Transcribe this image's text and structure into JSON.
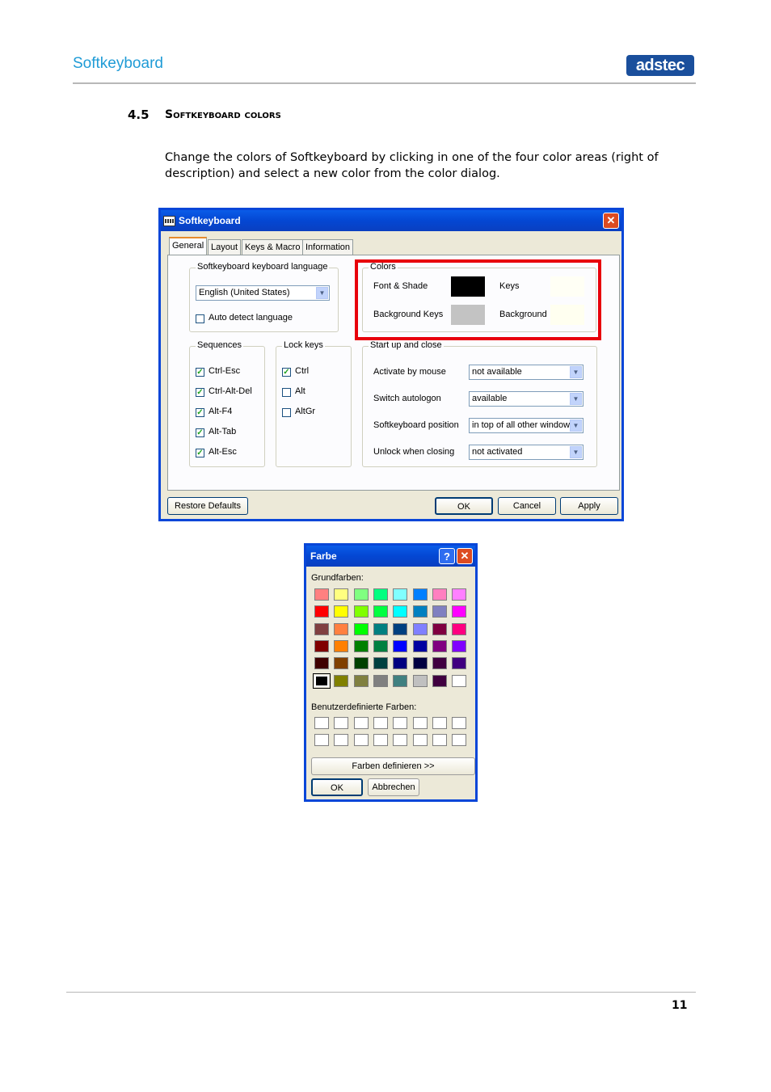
{
  "page": {
    "header_title": "Softkeyboard",
    "logo_text": "adstec",
    "section_number": "4.5",
    "section_title": "Softkeyboard colors",
    "paragraph": "Change the colors of Softkeyboard by clicking in one of the four color areas (right of description) and select a new color from the color dialog.",
    "page_number": "11"
  },
  "softkeyboard_dialog": {
    "title": "Softkeyboard",
    "tabs": [
      "General",
      "Layout",
      "Keys & Macro",
      "Information"
    ],
    "language_group": {
      "label": "Softkeyboard keyboard language",
      "selected": "English (United States)",
      "auto_detect_label": "Auto detect language",
      "auto_detect_checked": false
    },
    "colors_group": {
      "label": "Colors",
      "font_shade_label": "Font & Shade",
      "font_shade_color": "#000000",
      "keys_label": "Keys",
      "keys_color": "#fffff5",
      "bg_keys_label": "Background Keys",
      "bg_keys_color": "#c3c3c3",
      "background_label": "Background",
      "background_color": "#fffff0"
    },
    "sequences_group": {
      "label": "Sequences",
      "items": [
        {
          "label": "Ctrl-Esc",
          "checked": true
        },
        {
          "label": "Ctrl-Alt-Del",
          "checked": true
        },
        {
          "label": "Alt-F4",
          "checked": true
        },
        {
          "label": "Alt-Tab",
          "checked": true
        },
        {
          "label": "Alt-Esc",
          "checked": true
        }
      ]
    },
    "lock_keys_group": {
      "label": "Lock keys",
      "items": [
        {
          "label": "Ctrl",
          "checked": true
        },
        {
          "label": "Alt",
          "checked": false
        },
        {
          "label": "AltGr",
          "checked": false
        }
      ]
    },
    "startup_group": {
      "label": "Start up and close",
      "rows": [
        {
          "label": "Activate by mouse",
          "value": "not available"
        },
        {
          "label": "Switch autologon",
          "value": "available"
        },
        {
          "label": "Softkeyboard position",
          "value": "in top of all other windows"
        },
        {
          "label": "Unlock when closing",
          "value": "not activated"
        }
      ]
    },
    "buttons": {
      "restore": "Restore Defaults",
      "ok": "OK",
      "cancel": "Cancel",
      "apply": "Apply"
    }
  },
  "color_dialog": {
    "title": "Farbe",
    "basic_colors_label": "Grundfarben:",
    "basic_colors": [
      [
        "#ff8080",
        "#ffff80",
        "#80ff80",
        "#00ff80",
        "#80ffff",
        "#0080ff",
        "#ff80c0",
        "#ff80ff"
      ],
      [
        "#ff0000",
        "#ffff00",
        "#80ff00",
        "#00ff40",
        "#00ffff",
        "#0080c0",
        "#8080c0",
        "#ff00ff"
      ],
      [
        "#804040",
        "#ff8040",
        "#00ff00",
        "#008080",
        "#004080",
        "#8080ff",
        "#800040",
        "#ff0080"
      ],
      [
        "#800000",
        "#ff8000",
        "#008000",
        "#008040",
        "#0000ff",
        "#0000a0",
        "#800080",
        "#8000ff"
      ],
      [
        "#400000",
        "#804000",
        "#004000",
        "#004040",
        "#000080",
        "#000040",
        "#400040",
        "#400080"
      ],
      [
        "#000000",
        "#808000",
        "#808040",
        "#808080",
        "#408080",
        "#c0c0c0",
        "#400040",
        "#ffffff"
      ]
    ],
    "selected_color": "#000000",
    "custom_colors_label": "Benutzerdefinierte Farben:",
    "define_button": "Farben definieren >>",
    "ok": "OK",
    "cancel": "Abbrechen"
  }
}
